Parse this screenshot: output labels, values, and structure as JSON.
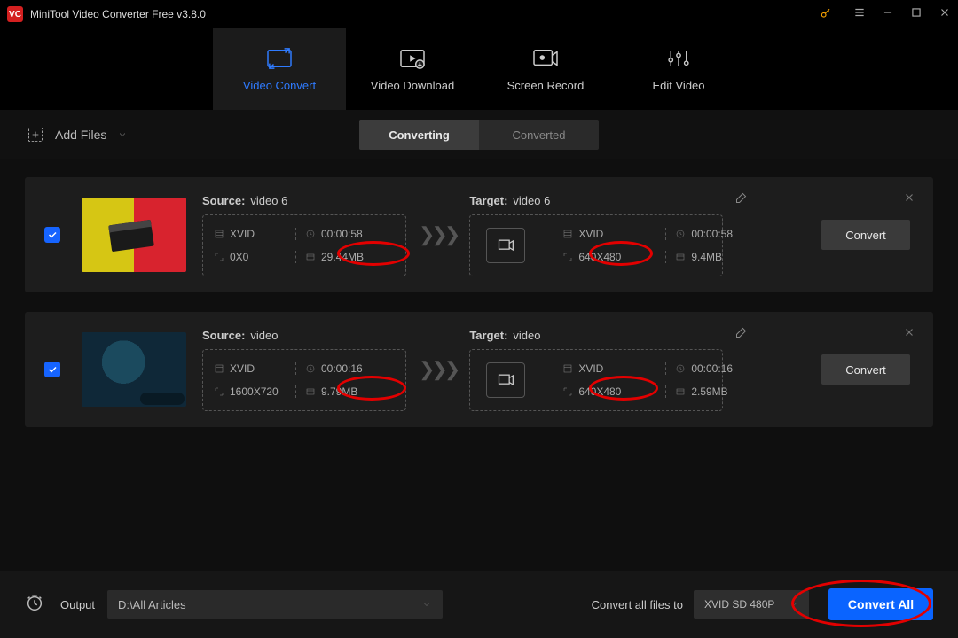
{
  "app": {
    "title": "MiniTool Video Converter Free v3.8.0"
  },
  "main_tabs": {
    "convert": "Video Convert",
    "download": "Video Download",
    "record": "Screen Record",
    "edit": "Edit Video"
  },
  "toolbar": {
    "add_files": "Add Files",
    "seg_converting": "Converting",
    "seg_converted": "Converted"
  },
  "labels": {
    "source": "Source:",
    "target": "Target:",
    "convert": "Convert"
  },
  "files": [
    {
      "source": {
        "name": "video 6",
        "codec": "XVID",
        "duration": "00:00:58",
        "resolution": "0X0",
        "size": "29.44MB"
      },
      "target": {
        "name": "video 6",
        "codec": "XVID",
        "duration": "00:00:58",
        "resolution": "640X480",
        "size": "9.4MB"
      }
    },
    {
      "source": {
        "name": "video",
        "codec": "XVID",
        "duration": "00:00:16",
        "resolution": "1600X720",
        "size": "9.79MB"
      },
      "target": {
        "name": "video",
        "codec": "XVID",
        "duration": "00:00:16",
        "resolution": "640X480",
        "size": "2.59MB"
      }
    }
  ],
  "bottom": {
    "output_label": "Output",
    "output_path": "D:\\All Articles",
    "convert_all_label": "Convert all files to",
    "format": "XVID SD 480P",
    "convert_all_btn": "Convert All"
  }
}
